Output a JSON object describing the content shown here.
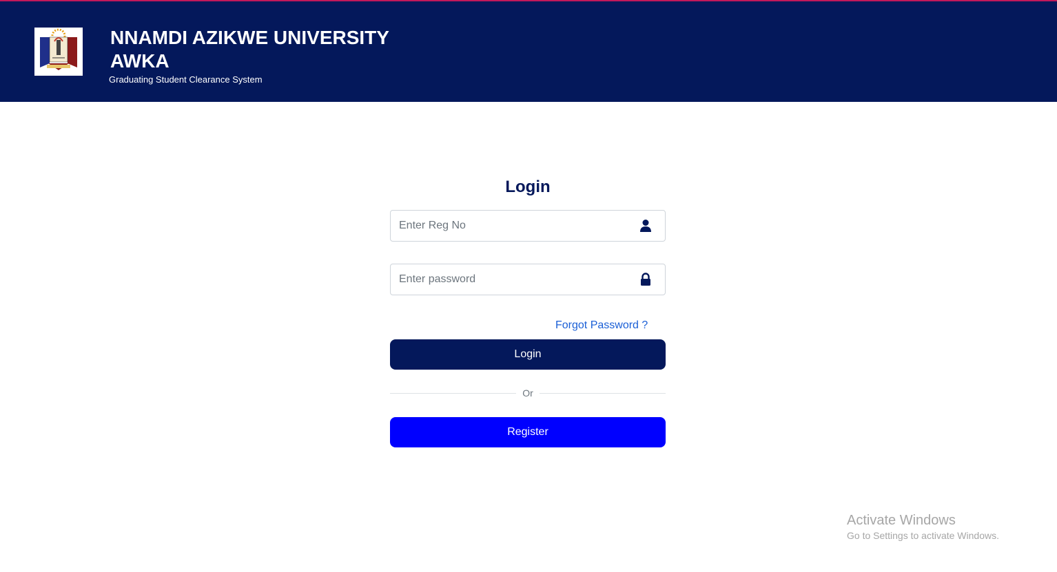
{
  "header": {
    "title_line1": "NNAMDI AZIKWE UNIVERSITY",
    "title_line2": "AWKA",
    "subtitle": "Graduating Student Clearance System",
    "logo_icon": "university-crest"
  },
  "login_form": {
    "title": "Login",
    "reg_no": {
      "placeholder": "Enter Reg No",
      "value": "",
      "icon": "user-icon"
    },
    "password": {
      "placeholder": "Enter password",
      "value": "",
      "icon": "lock-icon"
    },
    "forgot_password_label": "Forgot Password ?",
    "login_button_label": "Login",
    "divider_label": "Or",
    "register_button_label": "Register"
  },
  "watermark": {
    "title": "Activate Windows",
    "subtitle": "Go to Settings to activate Windows."
  },
  "colors": {
    "header_bg": "#04185b",
    "accent_line": "#c2185b",
    "login_button": "#04185b",
    "register_button": "#0000ff",
    "link": "#1a5fd6"
  }
}
